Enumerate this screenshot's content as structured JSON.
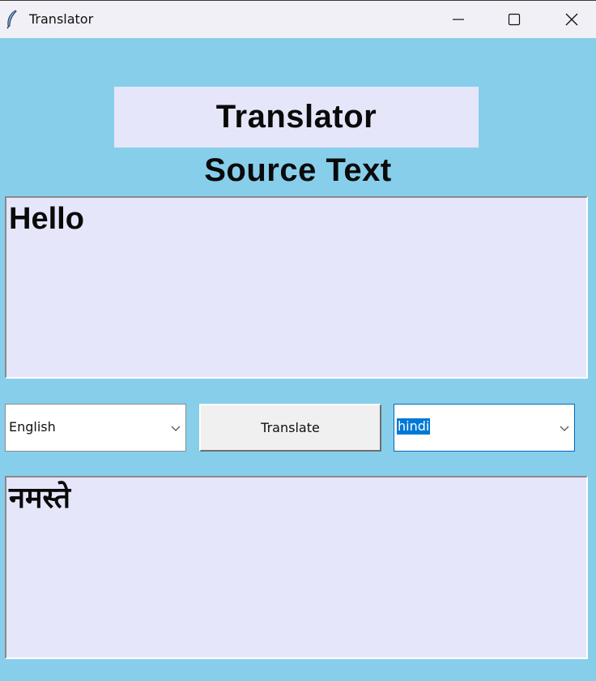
{
  "window": {
    "title": "Translator",
    "icon": "feather-icon",
    "controls": [
      "minimize-icon",
      "maximize-icon",
      "close-icon"
    ]
  },
  "header": {
    "title": "Translator"
  },
  "source": {
    "label": "Source Text",
    "text": "Hello"
  },
  "controls": {
    "source_language": "English",
    "translate_label": "Translate",
    "target_language": "hindi"
  },
  "target": {
    "text": "नमस्ते"
  },
  "colors": {
    "background": "#87ceeb",
    "panel": "#e6e6fa",
    "selection": "#0078d7"
  }
}
